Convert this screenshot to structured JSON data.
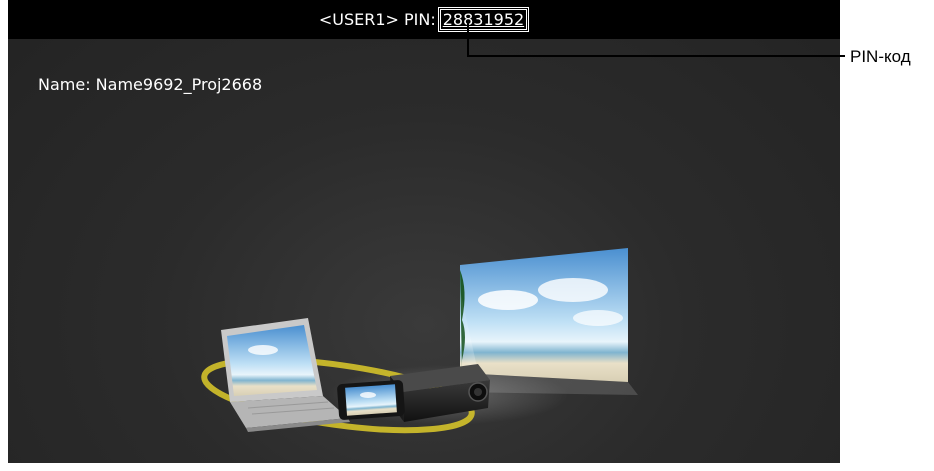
{
  "header": {
    "user_label": "<USER1> PIN:",
    "pin": "28831952"
  },
  "info": {
    "name_line": "Name: Name9692_Proj2668"
  },
  "annotation": {
    "pin_label": "PIN-код"
  },
  "colors": {
    "background": "#2b2b2b",
    "topbar": "#000000",
    "text": "#ffffff",
    "orbit": "#d4c22a"
  },
  "icons": [
    "laptop-icon",
    "smartphone-icon",
    "projector-icon",
    "projection-screen-icon"
  ]
}
